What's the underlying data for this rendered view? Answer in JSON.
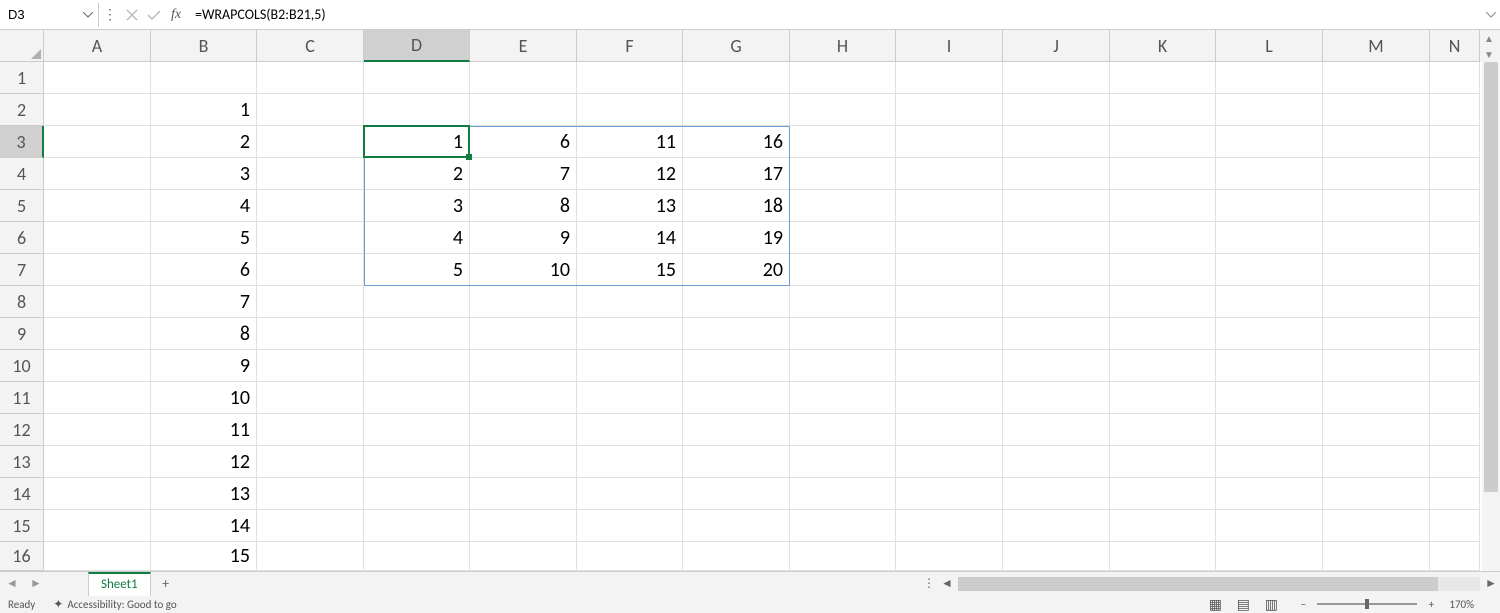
{
  "formula_bar": {
    "cell_ref": "D3",
    "formula": "=WRAPCOLS(B2:B21,5)"
  },
  "columns": [
    "A",
    "B",
    "C",
    "D",
    "E",
    "F",
    "G",
    "H",
    "I",
    "J",
    "K",
    "L",
    "M",
    "N"
  ],
  "active_col": "D",
  "rows": [
    "1",
    "2",
    "3",
    "4",
    "5",
    "6",
    "7",
    "8",
    "9",
    "10",
    "11",
    "12",
    "13",
    "14",
    "15",
    "16"
  ],
  "active_row": "3",
  "cells": {
    "B2": "1",
    "B3": "2",
    "B4": "3",
    "B5": "4",
    "B6": "5",
    "B7": "6",
    "B8": "7",
    "B9": "8",
    "B10": "9",
    "B11": "10",
    "B12": "11",
    "B13": "12",
    "B14": "13",
    "B15": "14",
    "B16": "15",
    "D3": "1",
    "D4": "2",
    "D5": "3",
    "D6": "4",
    "D7": "5",
    "E3": "6",
    "E4": "7",
    "E5": "8",
    "E6": "9",
    "E7": "10",
    "F3": "11",
    "F4": "12",
    "F5": "13",
    "F6": "14",
    "F7": "15",
    "G3": "16",
    "G4": "17",
    "G5": "18",
    "G6": "19",
    "G7": "20"
  },
  "tabs": {
    "active_sheet": "Sheet1"
  },
  "status": {
    "ready": "Ready",
    "accessibility": "Accessibility: Good to go",
    "zoom_pct": "170%"
  }
}
